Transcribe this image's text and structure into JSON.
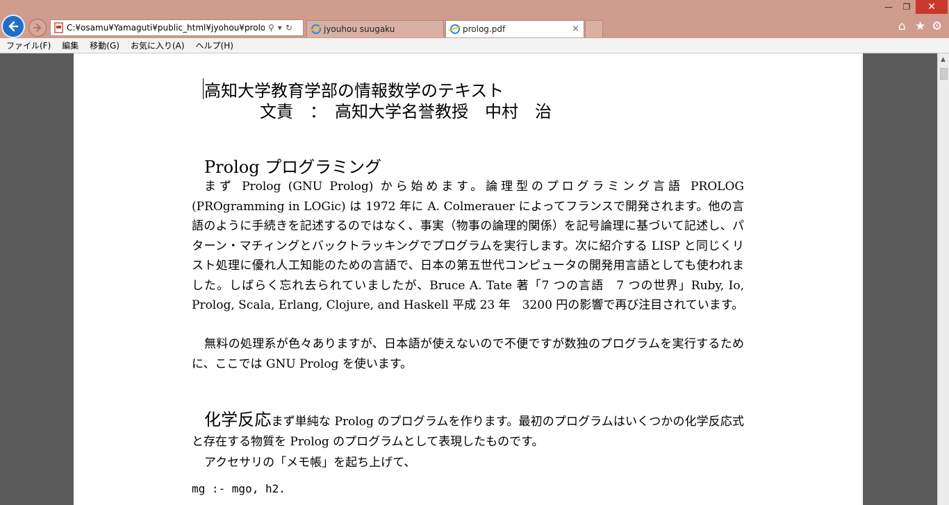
{
  "browser": {
    "address": "C:¥osamu¥Yamaguti¥public_html¥jyohou¥prolog",
    "tabs": [
      {
        "label": "jyouhou suugaku"
      },
      {
        "label": "prolog.pdf"
      }
    ],
    "close_tab_glyph": "×",
    "window_controls": {
      "minimize": "—",
      "maximize": "❐",
      "close": "✕"
    }
  },
  "menu": {
    "items": [
      {
        "label": "ファイル(F)"
      },
      {
        "label": "編集"
      },
      {
        "label": "移動(G)"
      },
      {
        "label": "お気に入り(A)"
      },
      {
        "label": "ヘルプ(H)"
      }
    ]
  },
  "document": {
    "title": "高知大学教育学部の情報数学のテキスト",
    "author": "文責　：　高知大学名誉教授　中村　治",
    "prolog_heading": "Prolog プログラミング",
    "para1": "まず Prolog (GNU Prolog) から始めます。論理型のプログラミング言語 PROLOG (PROgramming in LOGic) は 1972 年に A. Colmerauer によってフランスで開発されます。他の言語のように手続きを記述するのではなく、事実（物事の論理的関係）を記号論理に基づいて記述し、パターン・マチィングとバックトラッキングでプログラムを実行します。次に紹介する LISP と同じくリスト処理に優れ人工知能のための言語で、日本の第五世代コンピュータの開発用言語としても使われました。しばらく忘れ去られていましたが、Bruce A. Tate 著「7 つの言語　7 つの世界」Ruby, Io, Prolog, Scala, Erlang, Clojure, and Haskell 平成 23 年　3200 円の影響で再び注目されています。",
    "para2": "無料の処理系が色々ありますが、日本語が使えないので不便ですが数独のプログラムを実行するために、ここでは GNU Prolog を使います。",
    "chem_heading": "化学反応",
    "para3": "まず単純な Prolog のプログラムを作ります。最初のプログラムはいくつかの化学反応式と存在する物質を Prolog のプログラムとして表現したものです。",
    "para4": "アクセサリの「メモ帳」を起ち上げて、",
    "code": "mg :- mgo, h2."
  }
}
